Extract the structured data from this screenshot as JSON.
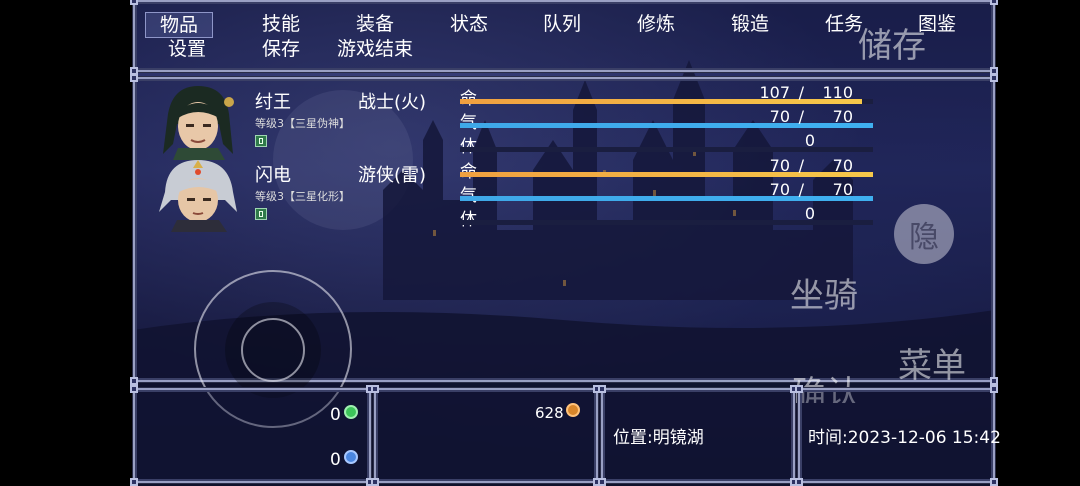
{
  "menu": {
    "row1": [
      "物品",
      "技能",
      "装备",
      "状态",
      "队列",
      "修炼",
      "锻造",
      "任务",
      "图鉴"
    ],
    "row2": [
      "设置",
      "保存",
      "游戏结束"
    ]
  },
  "party": [
    {
      "name": "纣王",
      "class": "战士(火)",
      "level": "等级3【三星伪神】",
      "stats": [
        {
          "label": "命",
          "current": "107",
          "sep": "/",
          "max": "110",
          "fill": 0.973,
          "color": "#f0a040"
        },
        {
          "label": "气",
          "current": "70",
          "sep": "/",
          "max": "70",
          "fill": 1.0,
          "color": "#3fa8e8"
        },
        {
          "label": "体",
          "value": "0"
        }
      ]
    },
    {
      "name": "闪电",
      "class": "游侠(雷)",
      "level": "等级3【三星化形】",
      "stats": [
        {
          "label": "命",
          "current": "70",
          "sep": "/",
          "max": "70",
          "fill": 1.0,
          "color": "#f0a040"
        },
        {
          "label": "气",
          "current": "70",
          "sep": "/",
          "max": "70",
          "fill": 1.0,
          "color": "#3fa8e8"
        },
        {
          "label": "体",
          "value": "0"
        }
      ]
    }
  ],
  "overlay": {
    "save": "储存",
    "hide": "隐",
    "mount": "坐骑",
    "menu": "菜单",
    "confirm": "确认"
  },
  "bottom": {
    "green_coin": "0",
    "blue_coin": "0",
    "gold": "628",
    "location": "位置:明镜湖",
    "time": "时间:2023-12-06 15:42"
  },
  "colors": {
    "hp": "#f0a040",
    "mp": "#3fa8e8",
    "green_coin": "#3cc45a",
    "blue_coin": "#4a86e0",
    "gold_coin": "#d8862a"
  }
}
